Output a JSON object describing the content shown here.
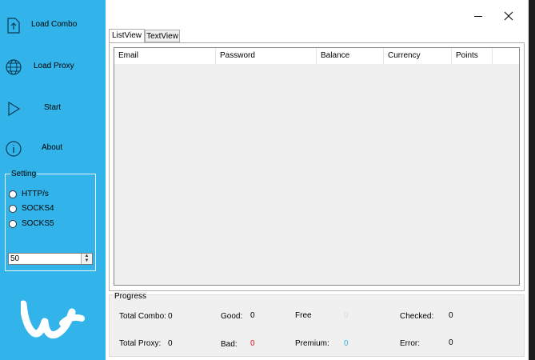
{
  "sidebar": {
    "items": [
      {
        "label": "Load Combo",
        "icon": "upload-file-icon"
      },
      {
        "label": "Load Proxy",
        "icon": "globe-icon"
      },
      {
        "label": "Start",
        "icon": "play-icon"
      },
      {
        "label": "About",
        "icon": "info-icon"
      }
    ],
    "setting": {
      "title": "Setting",
      "options": [
        "HTTP/s",
        "SOCKS4",
        "SOCKS5"
      ],
      "threads_value": "50"
    },
    "logo": "wish-logo"
  },
  "window": {
    "minimize": "—",
    "close": "✕"
  },
  "tabs": [
    "ListView",
    "TextView"
  ],
  "listview": {
    "columns": [
      "Email",
      "Password",
      "Balance",
      "Currency",
      "Points"
    ]
  },
  "progress": {
    "title": "Progress",
    "stats": {
      "total_combo": {
        "label": "Total Combo:",
        "value": "0"
      },
      "good": {
        "label": "Good:",
        "value": "0"
      },
      "free": {
        "label": "Free",
        "value": "0"
      },
      "checked": {
        "label": "Checked:",
        "value": "0"
      },
      "total_proxy": {
        "label": "Total Proxy:",
        "value": "0"
      },
      "bad": {
        "label": "Bad:",
        "value": "0"
      },
      "premium": {
        "label": "Premium:",
        "value": "0"
      },
      "error": {
        "label": "Error:",
        "value": "0"
      }
    }
  },
  "colors": {
    "sidebar": "#32b4ea",
    "bad": "#e81123",
    "premium": "#32b4ea",
    "free": "#d8d8d8"
  }
}
